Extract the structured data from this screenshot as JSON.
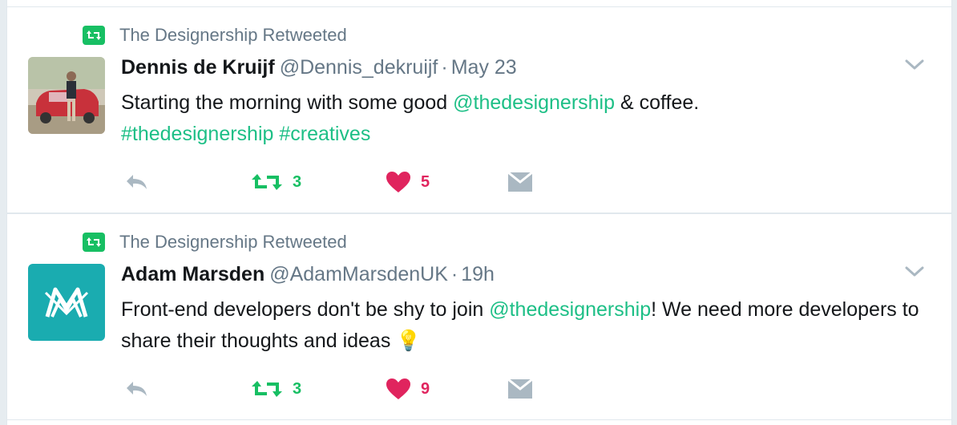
{
  "tweets": [
    {
      "context": "The Designership Retweeted",
      "fullname": "Dennis de Kruijf",
      "handle": "@Dennis_dekruijf",
      "separator": "·",
      "time": "May 23",
      "text_before": "Starting the morning with some good ",
      "mention": "@thedesignership",
      "text_after": " & coffee.",
      "hashtag1": "#thedesignership",
      "hashtag2": "#creatives",
      "retweets": "3",
      "likes": "5",
      "avatar_icon": "person-photo-avatar"
    },
    {
      "context": "The Designership Retweeted",
      "fullname": "Adam Marsden",
      "handle": "@AdamMarsdenUK",
      "separator": "·",
      "time": "19h",
      "text_before": "Front-end developers don't be shy to join ",
      "mention": "@thedesignership",
      "text_after": "! We need more developers to share their thoughts and ideas ",
      "emoji": "💡",
      "retweets": "3",
      "likes": "9",
      "avatar_icon": "am-logo-avatar"
    }
  ],
  "colors": {
    "accent": "#1dbf86",
    "retweet_green": "#17bf63",
    "like_red": "#e0245e",
    "muted": "#657786",
    "icon_gray": "#aab8c2"
  }
}
